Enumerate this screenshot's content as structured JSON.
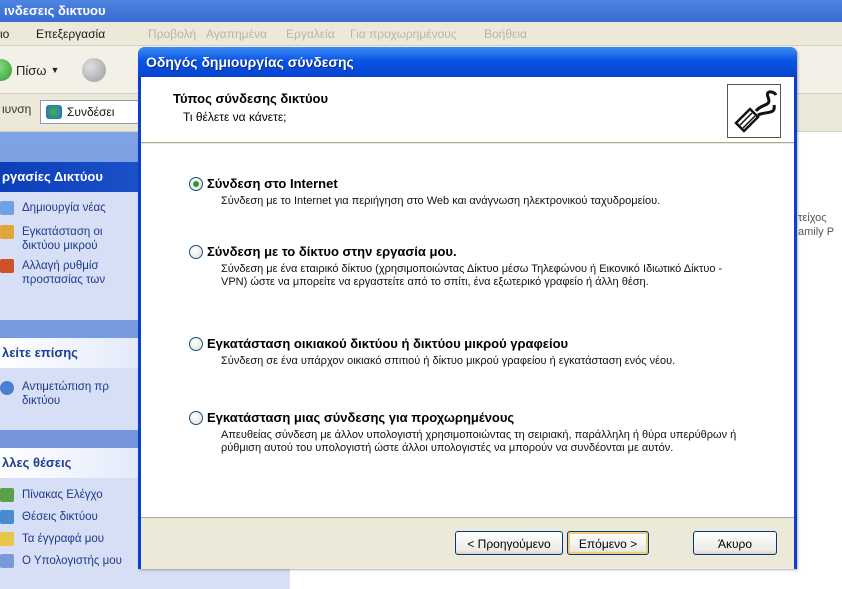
{
  "explorer": {
    "window_title": "ινδεσεις δικτυου",
    "menu": [
      "ιο",
      "Επεξεργασία",
      "Προβολή",
      "Αγαπημένα",
      "Εργαλεία",
      "Για προχωρημένους",
      "Βοήθεια"
    ],
    "toolbar": {
      "back_label": "Πίσω"
    },
    "address": {
      "left_text": "ιυνση",
      "tab_label": "Συνδέσει"
    },
    "main_snippet": [
      "τείχος",
      "amily P"
    ]
  },
  "task_pane": {
    "network_tasks_title": "ργασίες Δικτύου",
    "network_tasks": [
      [
        "Δημιουργία νέας"
      ],
      [
        "Εγκατάσταση οι",
        "δικτύου μικρού"
      ],
      [
        "Αλλαγή ρυθμίσ",
        "προστασίας των"
      ]
    ],
    "see_also_title": "λείτε επίσης",
    "see_also": [
      [
        "Αντιμετώπιση πρ",
        "δικτύου"
      ]
    ],
    "other_places_title": "λλες θέσεις",
    "other_places": [
      "Πίνακας Ελέγχο",
      "Θέσεις δικτύου",
      "Τα έγγραφά μου",
      "Ο Υπολογιστής μου"
    ]
  },
  "wizard": {
    "title": "Οδηγός δημιουργίας σύνδεσης",
    "header_title": "Τύπος σύνδεσης δικτύου",
    "header_subtitle": "Τι θέλετε να κάνετε;",
    "options": [
      {
        "label": "Σύνδεση στο Internet",
        "selected": true,
        "description": "Σύνδεση με το Internet για περιήγηση στο Web και ανάγνωση ηλεκτρονικού ταχυδρομείου."
      },
      {
        "label": "Σύνδεση με το δίκτυο στην εργασία μου.",
        "selected": false,
        "description": "Σύνδεση με ένα εταιρικό δίκτυο (χρησιμοποιώντας Δίκτυο μέσω Τηλεφώνου ή Εικονικό Ιδιωτικό Δίκτυο - VPN) ώστε να μπορείτε να εργαστείτε από το σπίτι, ένα εξωτερικό γραφείο ή άλλη θέση."
      },
      {
        "label": "Εγκατάσταση οικιακού δικτύου ή δικτύου μικρού γραφείου",
        "selected": false,
        "description": "Σύνδεση σε ένα υπάρχον οικιακό σπιτιού ή δίκτυο μικρού γραφείου ή εγκατάσταση ενός νέου."
      },
      {
        "label": "Εγκατάσταση μιας σύνδεσης για προχωρημένους",
        "selected": false,
        "description": "Απευθείας σύνδεση με άλλον υπολογιστή χρησιμοποιώντας τη σειριακή, παράλληλη ή θύρα υπερύθρων ή ρύθμιση αυτού του υπολογιστή ώστε άλλοι υπολογιστές να μπορούν να συνδέονται με αυτόν."
      }
    ],
    "buttons": {
      "back": "< Προηγούμενο",
      "next": "Επόμενο >",
      "cancel": "Άκυρο"
    }
  }
}
